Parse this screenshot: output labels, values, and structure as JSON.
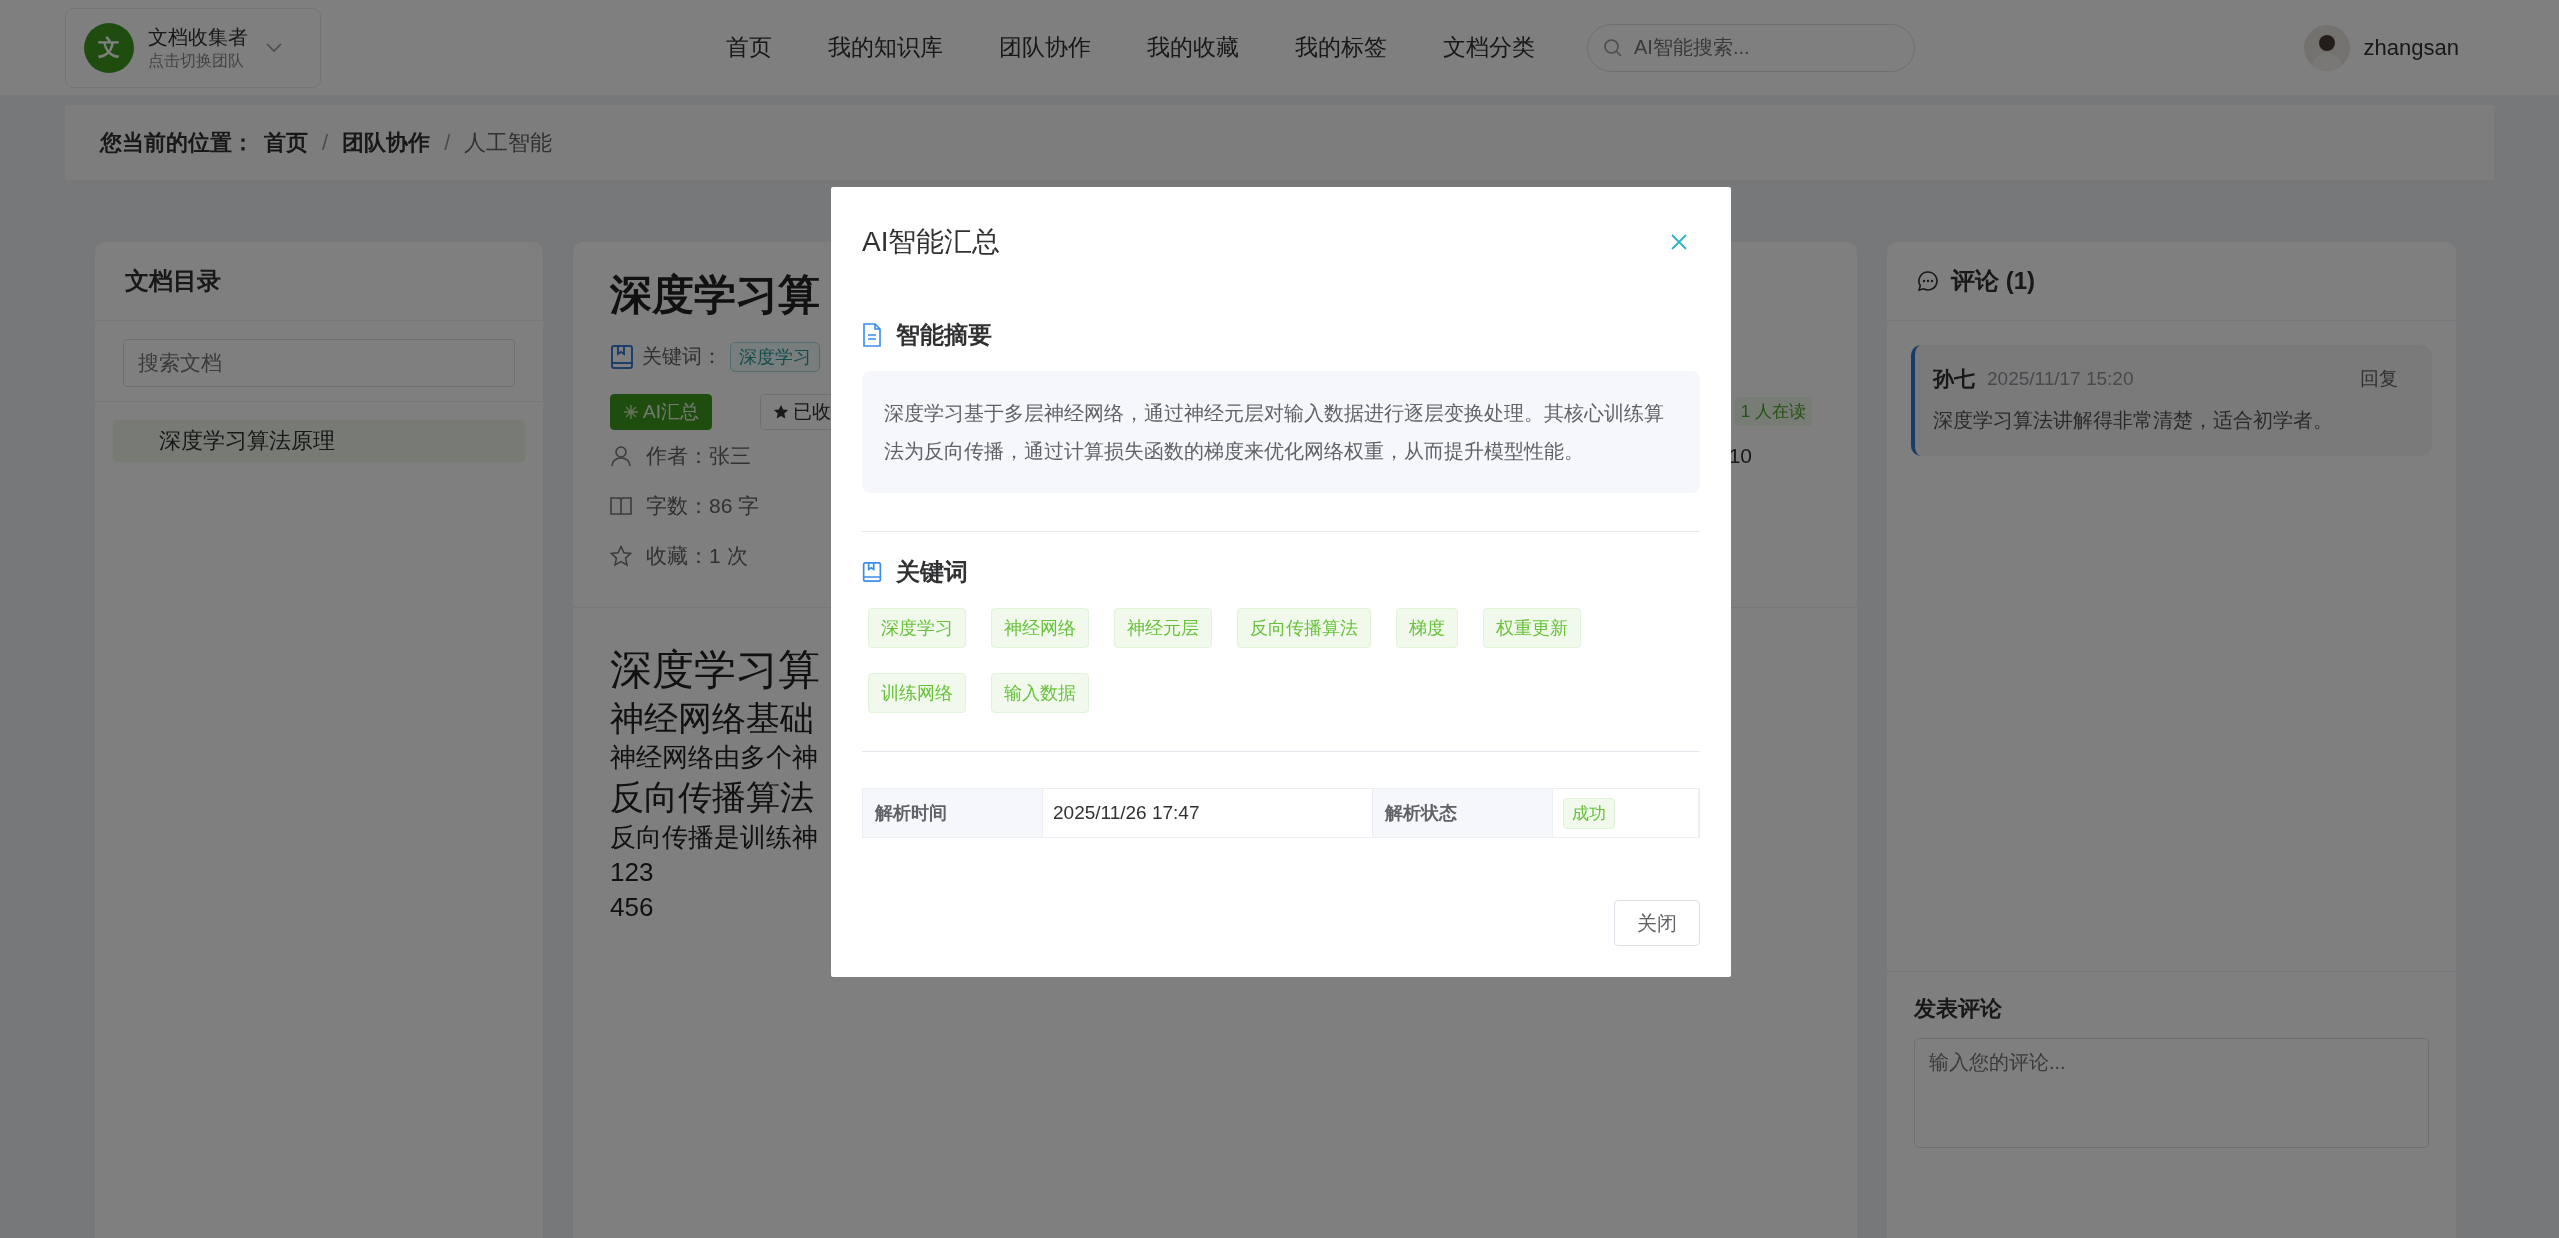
{
  "header": {
    "team": {
      "avatar": "文",
      "name": "文档收集者",
      "hint": "点击切换团队"
    },
    "nav": [
      {
        "label": "首页"
      },
      {
        "label": "我的知识库"
      },
      {
        "label": "团队协作"
      },
      {
        "label": "我的收藏"
      },
      {
        "label": "我的标签"
      },
      {
        "label": "文档分类"
      }
    ],
    "search": {
      "placeholder": "AI智能搜索..."
    },
    "user": {
      "name": "zhangsan"
    }
  },
  "breadcrumb": {
    "label": "您当前的位置：",
    "separator": "/",
    "items": [
      {
        "label": "首页",
        "current": false
      },
      {
        "label": "团队协作",
        "current": false
      },
      {
        "label": "人工智能",
        "current": true
      }
    ]
  },
  "sidebar": {
    "title": "文档目录",
    "search": {
      "placeholder": "搜索文档"
    },
    "items": [
      {
        "label": "深度学习算法原理",
        "selected": true
      }
    ]
  },
  "document": {
    "title": "深度学习算",
    "keywords_label": "关键词：",
    "keywords": [
      "深度学习"
    ],
    "actions": [
      {
        "label": "AI汇总",
        "kind": "primary"
      },
      {
        "label": "已收",
        "kind": "default"
      }
    ],
    "reading": "1 人在读",
    "meta": [
      {
        "kind": "author",
        "text": "作者：张三",
        "extra": "10"
      },
      {
        "kind": "words",
        "text": "字数：86 字"
      },
      {
        "kind": "favorites",
        "text": "收藏：1 次"
      }
    ],
    "content": [
      {
        "kind": "h1",
        "text": "深度学习算"
      },
      {
        "kind": "h2",
        "text": "神经网络基础"
      },
      {
        "kind": "p",
        "text": "神经网络由多个神"
      },
      {
        "kind": "h2",
        "text": "反向传播算法"
      },
      {
        "kind": "p",
        "text": "反向传播是训练神"
      },
      {
        "kind": "p",
        "text": "123"
      },
      {
        "kind": "p",
        "text": "456"
      }
    ]
  },
  "comments": {
    "title": "评论 (1)",
    "items": [
      {
        "author": "孙七",
        "time": "2025/11/17 15:20",
        "reply": "回复",
        "text": "深度学习算法讲解得非常清楚，适合初学者。"
      }
    ],
    "compose": {
      "title": "发表评论",
      "placeholder": "输入您的评论..."
    }
  },
  "dialog": {
    "title": "AI智能汇总",
    "summary": {
      "title": "智能摘要",
      "text": "深度学习基于多层神经网络，通过神经元层对输入数据进行逐层变换处理。其核心训练算法为反向传播，通过计算损失函数的梯度来优化网络权重，从而提升模型性能。"
    },
    "keywords": {
      "title": "关键词",
      "tags": [
        "深度学习",
        "神经网络",
        "神经元层",
        "反向传播算法",
        "梯度",
        "权重更新",
        "训练网络",
        "输入数据"
      ]
    },
    "details": [
      {
        "label": "解析时间",
        "value": "2025/11/26 17:47",
        "kind": "text"
      },
      {
        "label": "解析状态",
        "value": "成功",
        "kind": "tag"
      }
    ],
    "close_button": "关闭"
  }
}
